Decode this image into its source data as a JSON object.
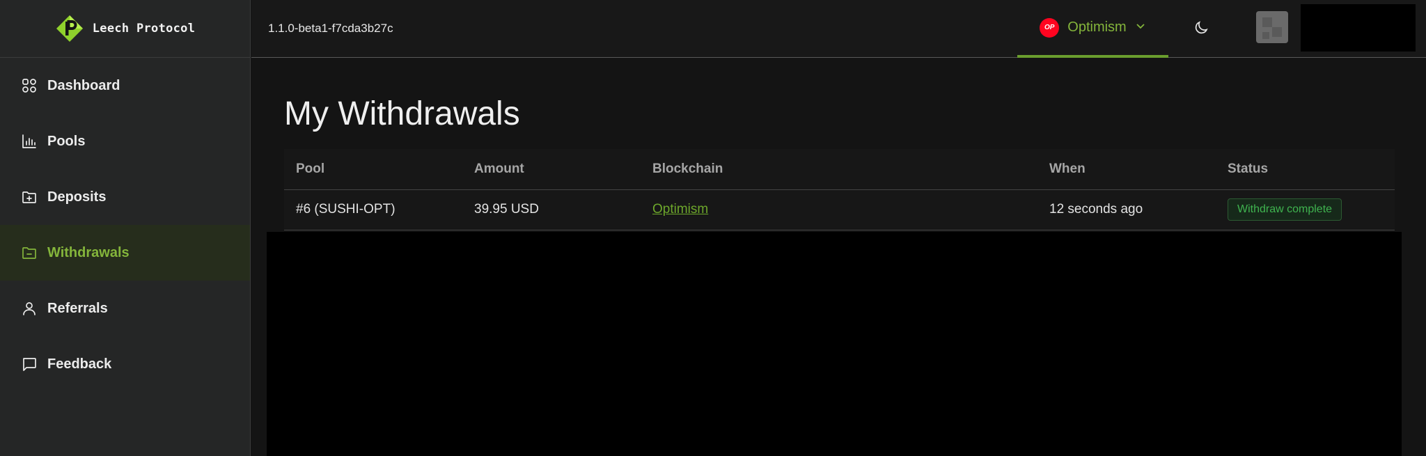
{
  "brand": {
    "name": "Leech Protocol"
  },
  "sidebar": {
    "items": [
      {
        "label": "Dashboard",
        "icon": "grid-icon",
        "active": false
      },
      {
        "label": "Pools",
        "icon": "bar-chart-icon",
        "active": false
      },
      {
        "label": "Deposits",
        "icon": "folder-plus-icon",
        "active": false
      },
      {
        "label": "Withdrawals",
        "icon": "folder-minus-icon",
        "active": true
      },
      {
        "label": "Referrals",
        "icon": "user-icon",
        "active": false
      },
      {
        "label": "Feedback",
        "icon": "message-icon",
        "active": false
      }
    ]
  },
  "topbar": {
    "version": "1.1.0-beta1-f7cda3b27c",
    "network": {
      "label": "Optimism",
      "badge": "OP",
      "badge_color": "#ff0420"
    },
    "theme_icon": "moon-icon"
  },
  "main": {
    "title": "My Withdrawals",
    "table": {
      "columns": [
        "Pool",
        "Amount",
        "Blockchain",
        "When",
        "Status"
      ],
      "rows": [
        {
          "pool": "#6 (SUSHI-OPT)",
          "amount": "39.95 USD",
          "blockchain": "Optimism",
          "when": "12 seconds ago",
          "status": "Withdraw complete"
        }
      ]
    }
  },
  "colors": {
    "accent": "#84b53b",
    "status_success": "#3fb34f",
    "background": "#141414",
    "sidebar": "#252626"
  }
}
